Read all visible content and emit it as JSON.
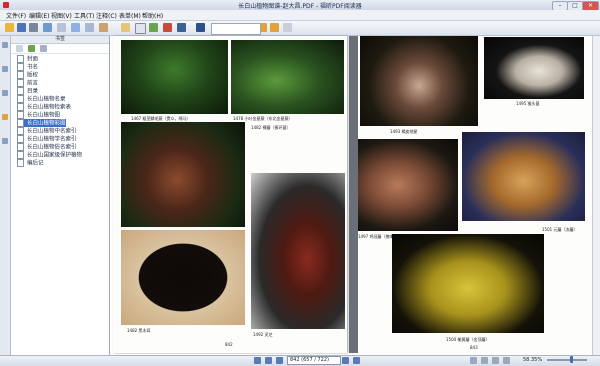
{
  "window": {
    "title": "长白山植物图谱-赵大昌.PDF - 福昕PDF阅读器",
    "controls": [
      "–",
      "□",
      "✕"
    ]
  },
  "menu": [
    "文件(F)",
    "编辑(E)",
    "视图(V)",
    "工具(T)",
    "注释(C)",
    "表单(M)",
    "帮助(H)"
  ],
  "toolbar": {
    "search_placeholder": "",
    "icons": [
      "open-icon",
      "save-icon",
      "print-icon",
      "email-icon",
      "hand-icon",
      "select-icon",
      "snapshot-icon",
      "find-icon",
      "prev-icon",
      "next-icon",
      "rotate-icon"
    ]
  },
  "sidebar": {
    "header": "书签",
    "items": [
      "封面",
      "书名",
      "版权",
      "前言",
      "目录",
      "长白山植物名录",
      "长白山植物检索表",
      "长白山植物图",
      "长白山植物彩图",
      "长白山植物中名索引",
      "长白山植物学名索引",
      "长白山植物俗名索引",
      "长白山国家级保护植物",
      "编后记"
    ],
    "selected_index": 8
  },
  "pages": {
    "left": {
      "captions": [
        "1467  粗茎鳞毛蕨（贯众，绵马）",
        "1478  小叶金星蕨（东北金星蕨）",
        "1482  裸蘑（蜜环菌）",
        "1482  黑木耳",
        "1492  灵芝"
      ],
      "page_number": "842"
    },
    "right": {
      "captions": [
        "1493  褐皮地星",
        "1495  猴头菌",
        "1497  鸡冠蘑（猪嘴菌）",
        "1501  元蘑（冻蘑）",
        "1504  榆黄蘑（金顶蘑）"
      ],
      "page_number": "843"
    }
  },
  "status": {
    "page_field": "842 (657 / 722)",
    "zoom": "58.35%"
  },
  "colors": {
    "selection": "#3a6ec9",
    "chrome": "#dde4ee"
  }
}
